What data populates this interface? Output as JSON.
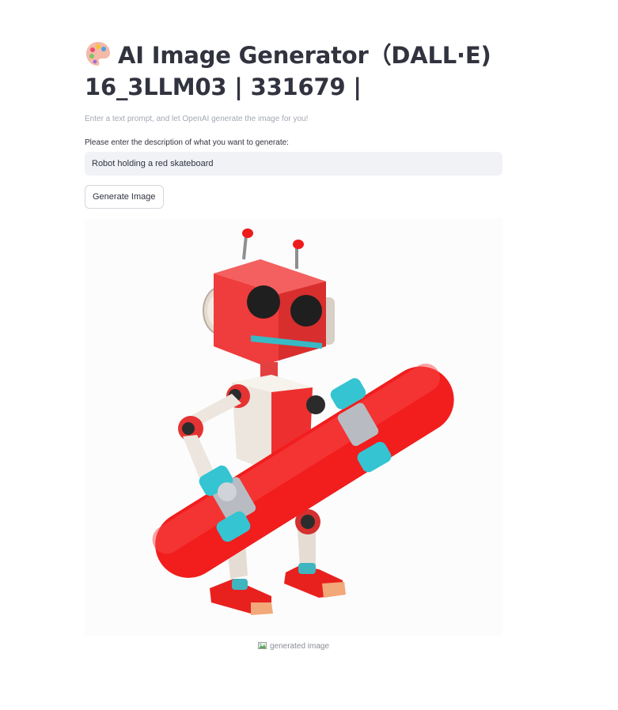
{
  "header": {
    "title_line1": "AI Image Generator（DALL·E)",
    "title_line2": "16_3LLM03 | 331679 |",
    "icon": "artist-palette-icon"
  },
  "intro": {
    "caption": "Enter a text prompt, and let OpenAI generate the image for you!"
  },
  "prompt": {
    "label": "Please enter the description of what you want to generate:",
    "value": "Robot holding a red skateboard"
  },
  "actions": {
    "generate_label": "Generate Image"
  },
  "result": {
    "alt": "generated image",
    "caption": "generated image",
    "caption_icon": "broken-image-icon"
  },
  "colors": {
    "text": "#31333f",
    "muted": "#a3a8b4",
    "input_bg": "#f0f2f6",
    "robot_red": "#f03a3a",
    "skateboard_red": "#f21d1d",
    "wheel_cyan": "#35c9d6"
  }
}
